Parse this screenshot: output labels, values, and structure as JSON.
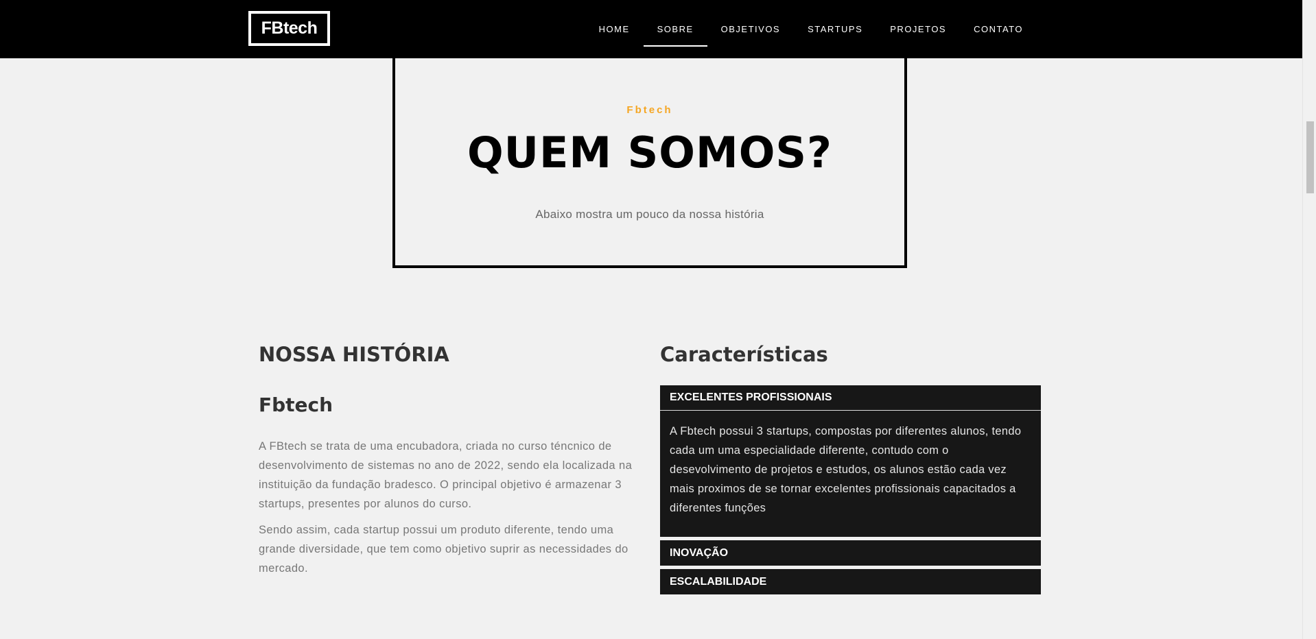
{
  "nav": {
    "logo": "FBtech",
    "items": [
      {
        "label": "HOME"
      },
      {
        "label": "SOBRE"
      },
      {
        "label": "OBJETIVOS"
      },
      {
        "label": "STARTUPS"
      },
      {
        "label": "PROJETOS"
      },
      {
        "label": "CONTATO"
      }
    ],
    "active": "SOBRE"
  },
  "hero": {
    "kicker": "Fbtech",
    "title": "QUEM SOMOS?",
    "subtitle": "Abaixo mostra um pouco da nossa história"
  },
  "history": {
    "heading": "NOSSA HISTÓRIA",
    "subheading": "Fbtech",
    "paragraphs": [
      "A FBtech se trata de uma encubadora, criada no curso téncnico de desenvolvimento de sistemas no ano de 2022, sendo ela localizada na instituição da fundação bradesco. O principal objetivo é armazenar 3 startups, presentes por alunos do curso.",
      "Sendo assim, cada startup possui um produto diferente, tendo uma grande diversidade, que tem como objetivo suprir as necessidades do mercado."
    ]
  },
  "features": {
    "heading": "Características",
    "items": [
      {
        "title": "EXCELENTES PROFISSIONAIS",
        "body": "A Fbtech possui 3 startups, compostas por diferentes alunos, tendo cada um uma especialidade diferente, contudo com o desevolvimento de projetos e estudos, os alunos estão cada vez mais proximos de se tornar excelentes profissionais capacitados a diferentes funções"
      },
      {
        "title": "INOVAÇÃO"
      },
      {
        "title": "ESCALABILIDADE"
      }
    ]
  }
}
